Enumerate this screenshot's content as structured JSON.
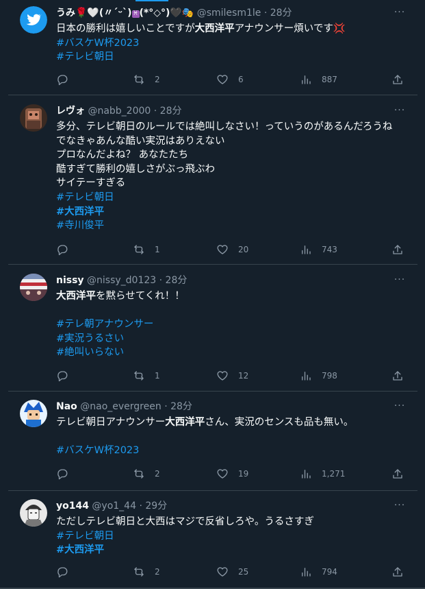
{
  "tweets": [
    {
      "name": "うみ🌹🤍(〃ˊᵕˋ)",
      "name_tail": "(*°◇°)🖤🎭",
      "handle": "@smilesm1le",
      "time": "28分",
      "lines": [
        [
          {
            "t": "日本の勝利は嬉しいことですが"
          },
          {
            "t": "大西洋平",
            "b": true
          },
          {
            "t": "アナウンサー煩いです💢"
          }
        ],
        [
          {
            "t": "#バスケW杯2023",
            "tag": true
          }
        ],
        [
          {
            "t": "#テレビ朝日",
            "tag": true
          }
        ]
      ],
      "replies": "",
      "retweets": "2",
      "likes": "6",
      "views": "887",
      "avatar_color": "#1d9bf0"
    },
    {
      "name": "レヴォ",
      "handle": "@nabb_2000",
      "time": "28分",
      "lines": [
        [
          {
            "t": "多分、テレビ朝日のルールでは絶叫しなさい！っていうのがあるんだろうね"
          }
        ],
        [
          {
            "t": "でなきゃあんな酷い実況はありえない"
          }
        ],
        [
          {
            "t": "プロなんだよね？ あなたたち"
          }
        ],
        [
          {
            "t": "酷すぎて勝利の嬉しさがぶっ飛ぶわ"
          }
        ],
        [
          {
            "t": "サイテーすぎる"
          }
        ],
        [
          {
            "t": "#テレビ朝日",
            "tag": true
          }
        ],
        [
          {
            "t": "#大西洋平",
            "tag": true,
            "b": true
          }
        ],
        [
          {
            "t": "#寺川俊平",
            "tag": true
          }
        ]
      ],
      "replies": "",
      "retweets": "1",
      "likes": "20",
      "views": "743",
      "avatar_color": "#6b4a3a"
    },
    {
      "name": "nissy",
      "handle": "@nissy_d0123",
      "time": "28分",
      "lines": [
        [
          {
            "t": "大西洋平",
            "b": true
          },
          {
            "t": "を黙らせてくれ！！"
          }
        ],
        [
          {
            "t": ""
          }
        ],
        [
          {
            "t": "#テレ朝アナウンサー",
            "tag": true
          }
        ],
        [
          {
            "t": "#実況うるさい",
            "tag": true
          }
        ],
        [
          {
            "t": "#絶叫いらない",
            "tag": true
          }
        ]
      ],
      "replies": "",
      "retweets": "1",
      "likes": "12",
      "views": "798",
      "avatar_color": "#7a5a66"
    },
    {
      "name": "Nao",
      "handle": "@nao_evergreen",
      "time": "28分",
      "lines": [
        [
          {
            "t": "テレビ朝日アナウンサー"
          },
          {
            "t": "大西洋平",
            "b": true
          },
          {
            "t": "さん、実況のセンスも品も無い。"
          }
        ],
        [
          {
            "t": ""
          }
        ],
        [
          {
            "t": "#バスケW杯2023",
            "tag": true
          }
        ]
      ],
      "replies": "",
      "retweets": "2",
      "likes": "19",
      "views": "1,271",
      "avatar_color": "#1e6fd0"
    },
    {
      "name": "yo144",
      "handle": "@yo1_44",
      "time": "29分",
      "lines": [
        [
          {
            "t": "ただしテレビ朝日と大西はマジで反省しろや。うるさすぎ"
          }
        ],
        [
          {
            "t": "#テレビ朝日",
            "tag": true
          }
        ],
        [
          {
            "t": "#大西洋平",
            "tag": true,
            "b": true
          }
        ]
      ],
      "replies": "",
      "retweets": "2",
      "likes": "25",
      "views": "794",
      "avatar_color": "#d8d8d8"
    }
  ],
  "ui": {
    "more_label": "···",
    "dot": "·",
    "accent_color": "#1d9bf0",
    "background_color": "#15202b"
  }
}
